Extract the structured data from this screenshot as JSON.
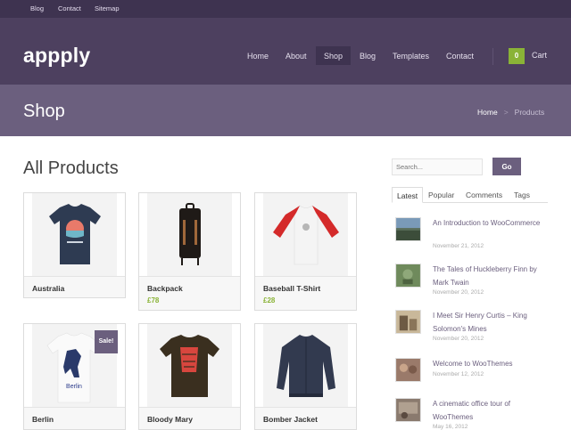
{
  "topbar": {
    "links": [
      "Blog",
      "Contact",
      "Sitemap"
    ]
  },
  "header": {
    "logo": "appply",
    "nav": [
      "Home",
      "About",
      "Shop",
      "Blog",
      "Templates",
      "Contact"
    ],
    "active_nav": "Shop",
    "cart_count": "0",
    "cart_label": "Cart"
  },
  "titlebar": {
    "title": "Shop",
    "breadcrumb": {
      "home": "Home",
      "separator": ">",
      "current": "Products"
    }
  },
  "main": {
    "heading": "All Products",
    "products": [
      {
        "name": "Australia",
        "price": "",
        "sale": ""
      },
      {
        "name": "Backpack",
        "price": "£78",
        "sale": ""
      },
      {
        "name": "Baseball T-Shirt",
        "price": "£28",
        "sale": ""
      },
      {
        "name": "Berlin",
        "price": "",
        "sale": "Sale!"
      },
      {
        "name": "Bloody Mary",
        "price": "",
        "sale": ""
      },
      {
        "name": "Bomber Jacket",
        "price": "",
        "sale": ""
      }
    ]
  },
  "sidebar": {
    "search": {
      "placeholder": "Search...",
      "button": "Go"
    },
    "tabs": [
      "Latest",
      "Popular",
      "Comments",
      "Tags"
    ],
    "active_tab": "Latest",
    "posts": [
      {
        "title": "An Introduction to WooCommerce",
        "date": "November 21, 2012"
      },
      {
        "title": "The Tales of Huckleberry Finn by Mark Twain",
        "date": "November 20, 2012"
      },
      {
        "title": "I Meet Sir Henry Curtis – King Solomon's Mines",
        "date": "November 20, 2012"
      },
      {
        "title": "Welcome to WooThemes",
        "date": "November 12, 2012"
      },
      {
        "title": "A cinematic office tour of WooThemes",
        "date": "May 16, 2012"
      }
    ]
  },
  "colors": {
    "topbar": "#3e3350",
    "header": "#4d405f",
    "titlebar": "#6b5f7e",
    "accent_green": "#8ab337",
    "link_purple": "#6b5f7e"
  }
}
